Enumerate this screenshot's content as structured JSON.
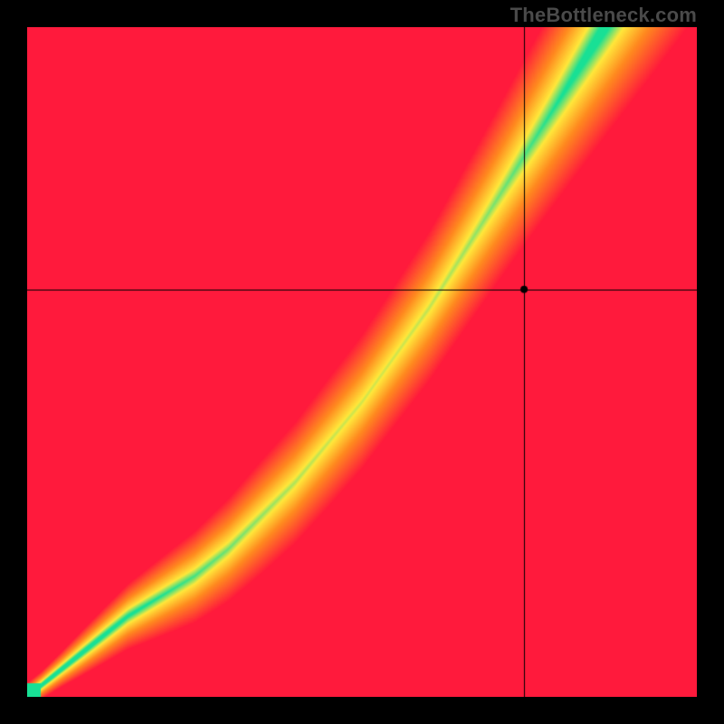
{
  "watermark": "TheBottleneck.com",
  "chart_data": {
    "type": "heatmap",
    "title": "",
    "xlabel": "",
    "ylabel": "",
    "xlim": [
      0,
      1
    ],
    "ylim": [
      0,
      1
    ],
    "grid": false,
    "legend": false,
    "crosshair": {
      "x": 0.743,
      "y": 0.608
    },
    "marker": {
      "x": 0.743,
      "y": 0.608,
      "radius": 4
    },
    "ridge": {
      "description": "y-position of green optimal band as function of x (normalized, y=0 bottom)",
      "x": [
        0.0,
        0.05,
        0.1,
        0.15,
        0.2,
        0.25,
        0.3,
        0.35,
        0.4,
        0.45,
        0.5,
        0.55,
        0.6,
        0.65,
        0.7,
        0.75,
        0.8,
        0.85,
        0.9,
        0.95,
        1.0
      ],
      "y": [
        0.0,
        0.04,
        0.08,
        0.12,
        0.15,
        0.18,
        0.22,
        0.27,
        0.32,
        0.38,
        0.44,
        0.51,
        0.58,
        0.66,
        0.74,
        0.82,
        0.9,
        0.98,
        1.06,
        1.14,
        1.22
      ],
      "half_width": [
        0.005,
        0.008,
        0.012,
        0.016,
        0.02,
        0.024,
        0.028,
        0.032,
        0.035,
        0.038,
        0.04,
        0.042,
        0.044,
        0.046,
        0.048,
        0.05,
        0.052,
        0.054,
        0.056,
        0.058,
        0.06
      ]
    },
    "colors": {
      "green": "#18e095",
      "yellow": "#ffe83b",
      "orange": "#ff8a1f",
      "red": "#ff1a3c"
    },
    "field_params": {
      "yellow_sigma_factor": 3.2,
      "corner_pull": 0.9,
      "corner_exponent": 1.4
    }
  }
}
